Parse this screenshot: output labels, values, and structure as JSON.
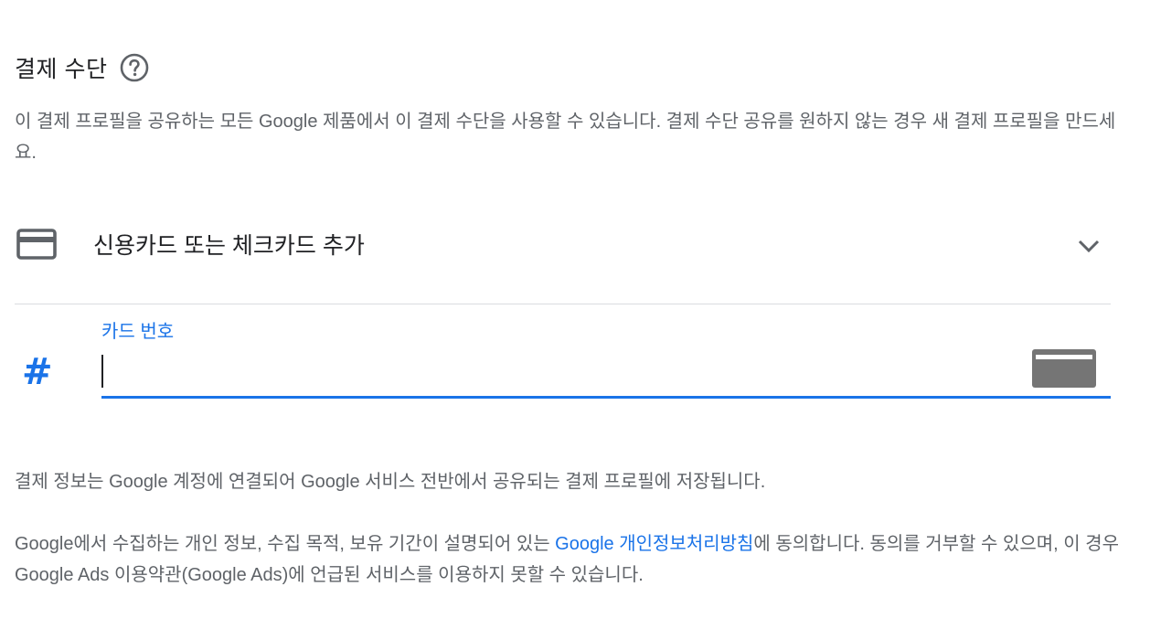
{
  "payment_method": {
    "title": "결제 수단",
    "help_icon": "help-circle-icon",
    "description": "이 결제 프로필을 공유하는 모든 Google 제품에서 이 결제 수단을 사용할 수 있습니다. 결제 수단 공유를 원하지 않는 경우 새 결제 프로필을 만드세요."
  },
  "add_card": {
    "icon": "credit-card-icon",
    "label": "신용카드 또는 체크카드 추가",
    "expand_icon": "chevron-down-icon"
  },
  "card_number_field": {
    "prefix_icon": "hash-icon",
    "prefix_glyph": "#",
    "label": "카드 번호",
    "value": "",
    "brand_icon": "generic-card-icon"
  },
  "info": {
    "profile_note": "결제 정보는 Google 계정에 연결되어 Google 서비스 전반에서 공유되는 결제 프로필에 저장됩니다.",
    "privacy_before": "Google에서 수집하는 개인 정보, 수집 목적, 보유 기간이 설명되어 있는 ",
    "privacy_link": "Google 개인정보처리방침",
    "privacy_after": "에 동의합니다. 동의를 거부할 수 있으며, 이 경우 Google Ads 이용약관(Google Ads)에 언급된 서비스를 이용하지 못할 수 있습니다."
  },
  "colors": {
    "accent": "#1a73e8",
    "text_primary": "#202124",
    "text_secondary": "#5f6368",
    "divider": "#dadce0",
    "icon_gray": "#5f6368"
  }
}
